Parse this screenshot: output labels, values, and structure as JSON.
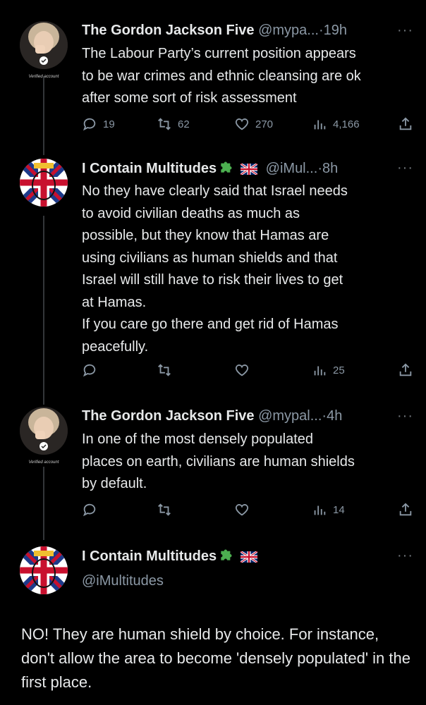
{
  "tweets": [
    {
      "name": "The Gordon Jackson Five",
      "handle": "@mypa...",
      "time": "19h",
      "text": "The Labour Party’s current position appears\nto be war crimes and ethnic cleansing are ok\nafter some sort of risk assessment",
      "stats": {
        "replies": "19",
        "retweets": "62",
        "likes": "270",
        "views": "4,166"
      },
      "avatar_icon": "woman-hand-face-avatar",
      "badge_label": "Verified account"
    },
    {
      "name": "I Contain Multitudes",
      "handle": "@iMul...",
      "time": "8h",
      "text": "No they have clearly said that Israel needs\nto avoid civilian deaths as much as\npossible, but they know that Hamas are\nusing civilians as human shields and that\nIsrael will still have to risk their lives to get\nat Hamas.\nIf you care go there and get rid of Hamas\npeacefully.",
      "stats": {
        "replies": "",
        "retweets": "",
        "likes": "",
        "views": "25"
      },
      "avatar_icon": "union-jack-face-avatar"
    },
    {
      "name": "The Gordon Jackson Five",
      "handle": "@mypal...",
      "time": "4h",
      "text": "In one of the most densely populated\nplaces on earth, civilians are human shields\nby default.",
      "stats": {
        "replies": "",
        "retweets": "",
        "likes": "",
        "views": "14"
      },
      "avatar_icon": "woman-hand-face-avatar",
      "badge_label": "Verified account"
    },
    {
      "name": "I Contain Multitudes",
      "handle": "@iMultitudes",
      "text": "NO! They are human shield by choice. For instance, don't allow the area to become 'densely populated' in the first place.",
      "avatar_icon": "union-jack-face-avatar"
    }
  ],
  "separator": "·",
  "more_label": "···",
  "colors": {
    "background": "#000000",
    "text": "#e7e9ea",
    "muted": "#8b98a5",
    "puzzle": "#4caf50"
  }
}
